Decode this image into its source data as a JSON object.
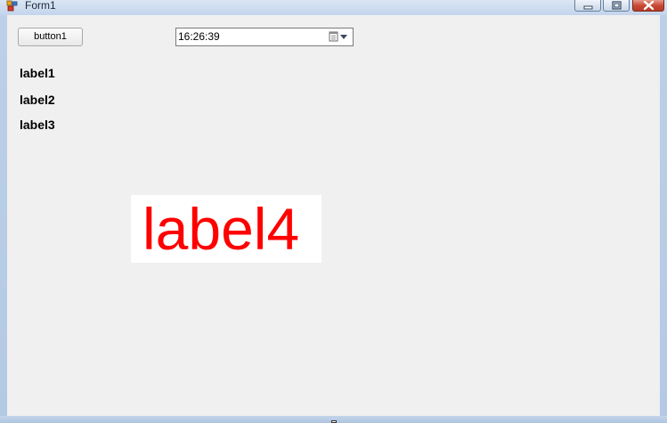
{
  "window": {
    "title": "Form1"
  },
  "titlebar_buttons": {
    "minimize_icon": "minimize-icon",
    "maximize_icon": "restore-icon",
    "close_icon": "close-icon"
  },
  "form": {
    "button1_label": "button1",
    "datetime_value": "16:26:39",
    "datetime_dropdown_icon": "calendar-dropdown-icon",
    "label1": "label1",
    "label2": "label2",
    "label3": "label3",
    "label4": "label4"
  },
  "colors": {
    "label4_text": "#ff0000",
    "label4_background": "#ffffff",
    "form_background": "#f0f0f0"
  }
}
